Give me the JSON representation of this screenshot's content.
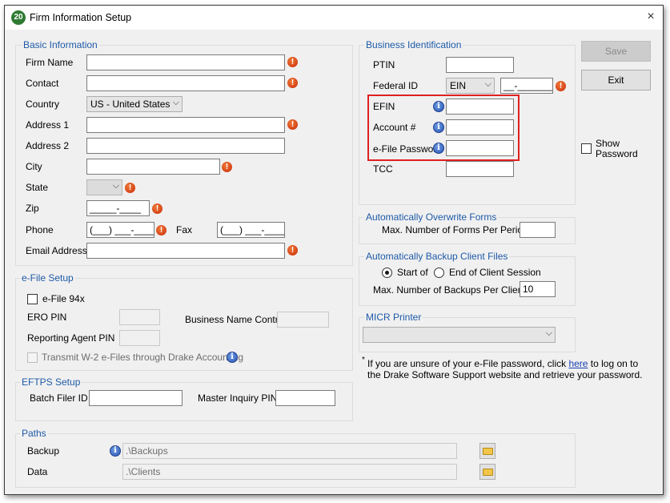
{
  "window": {
    "app_icon_text": "20",
    "title": "Firm Information Setup",
    "close_glyph": "×"
  },
  "basic_info": {
    "legend": "Basic Information",
    "firm_name_label": "Firm Name",
    "contact_label": "Contact",
    "country_label": "Country",
    "country_value": "US - United States",
    "address1_label": "Address 1",
    "address2_label": "Address 2",
    "city_label": "City",
    "state_label": "State",
    "zip_label": "Zip",
    "zip_mask": "_____-____",
    "phone_label": "Phone",
    "phone_mask": "(___) ___-____",
    "fax_label": "Fax",
    "fax_mask": "(___) ___-____",
    "email_label": "Email Address"
  },
  "efile_setup": {
    "legend": "e-File Setup",
    "efile94x_label": "e-File 94x",
    "ero_pin_label": "ERO PIN",
    "business_name_control_label": "Business Name Control",
    "reporting_agent_pin_label": "Reporting Agent PIN",
    "transmit_w2_label": "Transmit W-2 e-Files through Drake Accounting"
  },
  "eftps_setup": {
    "legend": "EFTPS Setup",
    "batch_filer_label": "Batch Filer ID",
    "master_inquiry_label": "Master Inquiry PIN"
  },
  "paths": {
    "legend": "Paths",
    "backup_label": "Backup",
    "backup_value": ".\\Backups",
    "data_label": "Data",
    "data_value": ".\\Clients"
  },
  "business_id": {
    "legend": "Business Identification",
    "ptin_label": "PTIN",
    "federal_id_label": "Federal ID",
    "federal_id_type": "EIN",
    "federal_id_mask": "__-_______",
    "efin_label": "EFIN",
    "account_label": "Account #",
    "efile_password_label": "e-File Password",
    "tcc_label": "TCC"
  },
  "overwrite_forms": {
    "legend": "Automatically Overwrite Forms",
    "max_forms_label": "Max. Number of Forms Per Period",
    "max_forms_value": ""
  },
  "backup_client_files": {
    "legend": "Automatically Backup Client Files",
    "start_of_label": "Start of",
    "end_of_session_label": "End of Client Session",
    "max_backups_label": "Max. Number of Backups Per Client",
    "max_backups_value": "10"
  },
  "micr_printer": {
    "legend": "MICR Printer",
    "selected": ""
  },
  "buttons": {
    "save_label": "Save",
    "exit_label": "Exit",
    "show_password_line1": "Show",
    "show_password_line2": "Password"
  },
  "note": {
    "asterisk": "*",
    "text_before": "If you are unsure of your e-File password, click ",
    "link_text": "here",
    "text_after": " to log on to",
    "line2": "the Drake Software Support website and retrieve your password."
  },
  "icons": {
    "warning_glyph": "!",
    "info_glyph": "i",
    "chevron_glyph": "⌵"
  },
  "colors": {
    "legend_blue": "#1e5aa8",
    "highlight_red": "#e02020",
    "warning_orange": "#d9400f",
    "info_blue": "#2a56b8"
  }
}
